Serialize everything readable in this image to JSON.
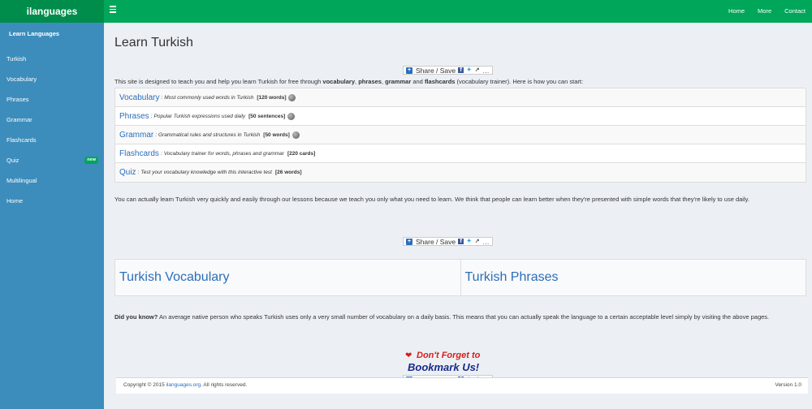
{
  "brand": "ilanguages",
  "topnav": {
    "home": "Home",
    "more": "More",
    "contact": "Contact"
  },
  "sidebar": {
    "header": "Learn Languages",
    "items": [
      {
        "label": "Turkish"
      },
      {
        "label": "Vocabulary"
      },
      {
        "label": "Phrases"
      },
      {
        "label": "Grammar"
      },
      {
        "label": "Flashcards"
      },
      {
        "label": "Quiz",
        "badge": "new"
      },
      {
        "label": "Multilingual"
      },
      {
        "label": "Home"
      }
    ]
  },
  "main": {
    "title": "Learn Turkish",
    "share_label": "Share / Save",
    "share_more": "…",
    "intro_parts": {
      "a": "This site is designed to teach you and help you learn Turkish for free through ",
      "b": "vocabulary",
      "c": ", ",
      "d": "phrases",
      "e": ", ",
      "f": "grammar",
      "g": " and ",
      "h": "flashcards",
      "i": " (vocabulary trainer). Here is how you can start:"
    },
    "list": [
      {
        "label": "Vocabulary",
        "sep": ":",
        "desc": "Most commonly used words in Turkish",
        "count": "[120 words]",
        "audio": true
      },
      {
        "label": "Phrases",
        "sep": ":",
        "desc": "Popular Turkish expressions used daily",
        "count": "[50 sentences]",
        "audio": true
      },
      {
        "label": "Grammar",
        "sep": ":",
        "desc": "Grammatical rules and structures in Turkish",
        "count": "[50 words]",
        "audio": true
      },
      {
        "label": "Flashcards",
        "sep": ":",
        "desc": "Vocabulary trainer for words, phrases and grammar",
        "count": "[220 cards]",
        "audio": false
      },
      {
        "label": "Quiz",
        "sep": ":",
        "desc": "Test your vocabulary knowledge with this interactive test",
        "count": "[26 words]",
        "audio": false
      }
    ],
    "paragraph1": "You can actually learn Turkish very quickly and easily through our lessons because we teach you only what you need to learn. We think that people can learn better when they're presented with simple words that they're likely to use daily.",
    "cards": [
      "Turkish Vocabulary",
      "Turkish Phrases"
    ],
    "did_you_know_label": "Did you know?",
    "did_you_know_text": " An average native person who speaks Turkish uses only a very small number of vocabulary on a daily basis. This means that you can actually speak the language to a certain acceptable level simply by visiting the above pages.",
    "bookmark_line1": "Don't Forget to",
    "bookmark_line2": "Bookmark Us!"
  },
  "footer": {
    "copyright_prefix": "Copyright © 2015 ",
    "copyright_link": "ilanguages.org",
    "copyright_suffix": ". All rights reserved.",
    "version": "Version 1.0"
  },
  "colors": {
    "header_green": "#00a65a",
    "brand_green": "#008d4c",
    "sidebar_blue": "#3c8dbc",
    "link_blue": "#2a6ebb",
    "page_bg": "#ecf0f5"
  }
}
